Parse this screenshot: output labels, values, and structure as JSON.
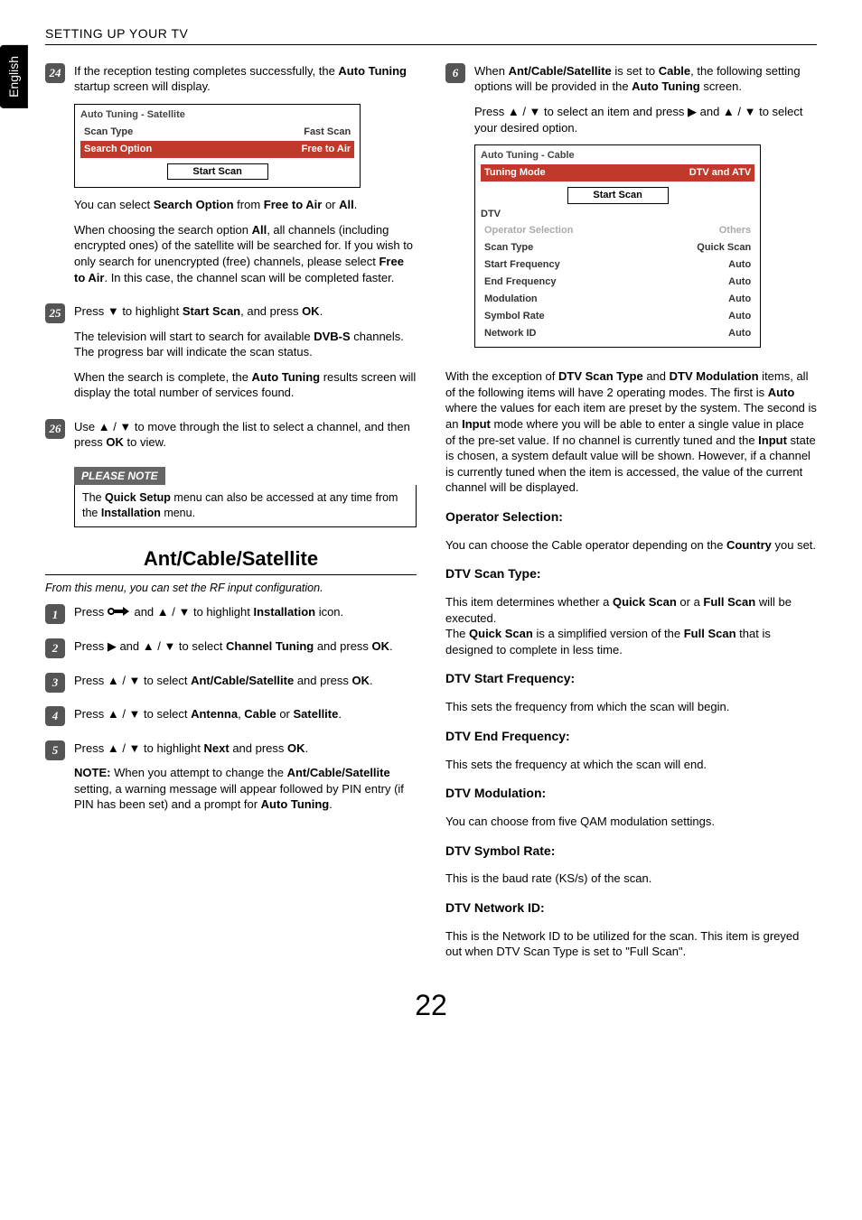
{
  "lang_tab": "English",
  "header": "SETTING UP YOUR TV",
  "page_number": "22",
  "left": {
    "step24": {
      "num": "24",
      "p1": "If the reception testing completes successfully, the ",
      "b1": "Auto Tuning",
      "p1b": " startup screen will display.",
      "panel": {
        "title": "Auto Tuning - Satellite",
        "row1_l": "Scan Type",
        "row1_r": "Fast Scan",
        "row2_l": "Search Option",
        "row2_r": "Free to Air",
        "btn": "Start Scan"
      },
      "p2a": "You can select ",
      "b2a": "Search Option",
      "p2b": " from ",
      "b2b": "Free to Air",
      "p2c": " or ",
      "b2c": "All",
      "p2d": ".",
      "p3a": "When choosing the search option ",
      "b3a": "All",
      "p3b": ", all channels (including encrypted ones) of the satellite will be searched for. If you wish to only search for unencrypted (free) channels, please select ",
      "b3b": "Free to Air",
      "p3c": ". In this case, the channel scan will be completed faster."
    },
    "step25": {
      "num": "25",
      "p1a": "Press ▼ to highlight ",
      "b1": "Start Scan",
      "p1b": ", and press ",
      "b2": "OK",
      "p1c": ".",
      "p2a": "The television will start to search for available ",
      "b3": "DVB-S",
      "p2b": " channels. The progress bar will indicate the scan status.",
      "p3a": "When the search is complete, the ",
      "b4": "Auto Tuning",
      "p3b": " results screen will display the total number of services found."
    },
    "step26": {
      "num": "26",
      "p1a": "Use ▲ / ▼ to move through the list to select a channel, and then press ",
      "b1": "OK",
      "p1b": " to view."
    },
    "note_label": "PLEASE NOTE",
    "note_a": "The ",
    "note_b": "Quick Setup",
    "note_c": " menu can also be accessed at any time from the ",
    "note_d": "Installation",
    "note_e": " menu.",
    "sec_title": "Ant/Cable/Satellite",
    "sec_intro": "From this menu, you can set the RF input configuration.",
    "step1": {
      "num": "1",
      "txt_a": "Press ",
      "txt_b": " and ▲ / ▼ to highlight ",
      "b1": "Installation",
      "txt_c": " icon."
    },
    "step2": {
      "num": "2",
      "txt_a": "Press ▶ and ▲ / ▼ to select ",
      "b1": "Channel Tuning",
      "txt_b": " and press ",
      "b2": "OK",
      "txt_c": "."
    },
    "step3": {
      "num": "3",
      "txt_a": "Press ▲ / ▼ to select ",
      "b1": "Ant/Cable/Satellite",
      "txt_b": " and press ",
      "b2": "OK",
      "txt_c": "."
    },
    "step4": {
      "num": "4",
      "txt_a": "Press ▲ / ▼ to select ",
      "b1": "Antenna",
      "txt_b": ", ",
      "b2": "Cable",
      "txt_c": " or ",
      "b3": "Satellite",
      "txt_d": "."
    },
    "step5": {
      "num": "5",
      "txt_a": "Press ▲ / ▼ to highlight ",
      "b1": "Next",
      "txt_b": " and press ",
      "b2": "OK",
      "txt_c": ".",
      "note_a": "NOTE:",
      "note_b": " When you attempt to change the ",
      "b3": "Ant/Cable/Satellite",
      "note_c": " setting, a warning message will appear followed by PIN entry (if PIN has been set) and a prompt for ",
      "b4": "Auto Tuning",
      "note_d": "."
    }
  },
  "right": {
    "step6": {
      "num": "6",
      "p1a": "When ",
      "b1": "Ant/Cable/Satellite",
      "p1b": " is set to ",
      "b2": "Cable",
      "p1c": ", the following setting options will be provided in the ",
      "b3": "Auto Tuning",
      "p1d": " screen.",
      "p2a": "Press ▲ / ▼ to select an item and press ▶ and ▲ / ▼ to select your desired option.",
      "panel": {
        "title": "Auto Tuning - Cable",
        "row_hl_l": "Tuning Mode",
        "row_hl_r": "DTV and ATV",
        "btn": "Start Scan",
        "dtv": "DTV",
        "rows": [
          {
            "l": "Operator Selection",
            "r": "Others",
            "muted": true
          },
          {
            "l": "Scan Type",
            "r": "Quick Scan"
          },
          {
            "l": "Start Frequency",
            "r": "Auto"
          },
          {
            "l": "End Frequency",
            "r": "Auto"
          },
          {
            "l": "Modulation",
            "r": "Auto"
          },
          {
            "l": "Symbol Rate",
            "r": "Auto"
          },
          {
            "l": "Network ID",
            "r": "Auto"
          }
        ]
      }
    },
    "para_a": "With the exception of ",
    "para_b1": "DTV Scan Type",
    "para_c": " and ",
    "para_b2": "DTV Modulation",
    "para_d": " items, all of the following items will have 2 operating modes. The first is ",
    "para_b3": "Auto",
    "para_e": " where the values for each item are preset by the system. The second is an ",
    "para_b4": "Input",
    "para_f": " mode where you will be able to enter a single value in place of the pre-set value. If no channel is currently tuned and the ",
    "para_b5": "Input",
    "para_g": " state is chosen, a system default value will be shown. However, if a channel is currently tuned when the item is accessed, the value of the current channel will be displayed.",
    "h_op": "Operator Selection:",
    "op_a": "You can choose the Cable operator depending on the ",
    "op_b": "Country",
    "op_c": " you set.",
    "h_st": "DTV Scan Type:",
    "st_a": "This item determines whether a ",
    "st_b1": "Quick Scan",
    "st_c": " or a ",
    "st_b2": "Full Scan",
    "st_d": " will be executed.",
    "st_e": "The ",
    "st_b3": "Quick Scan",
    "st_f": " is a simplified version of the ",
    "st_b4": "Full Scan",
    "st_g": " that is designed to complete in less time.",
    "h_sf": "DTV Start Frequency:",
    "sf": "This sets the frequency from which the scan will begin.",
    "h_ef": "DTV End Frequency:",
    "ef": "This sets the frequency at which the scan will end.",
    "h_mod": "DTV Modulation:",
    "mod": "You can choose from five QAM modulation settings.",
    "h_sr": "DTV Symbol Rate:",
    "sr": "This is the baud rate (KS/s) of the scan.",
    "h_nid": "DTV Network ID:",
    "nid": "This is the Network ID to be utilized for the scan. This item is greyed out when DTV Scan Type is set to \"Full Scan\"."
  }
}
